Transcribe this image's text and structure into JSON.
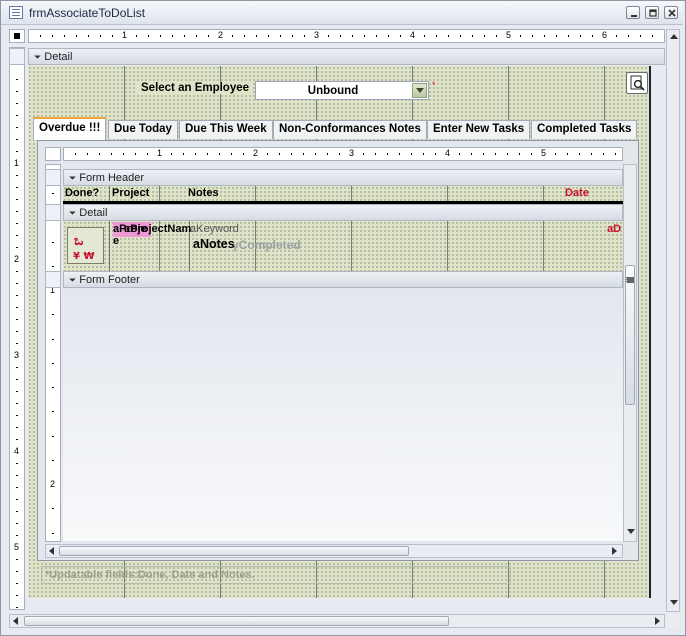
{
  "window": {
    "title": "frmAssociateToDoList"
  },
  "ruler": {
    "top_numbers": [
      "1",
      "2",
      "3",
      "4",
      "5",
      "6"
    ],
    "left_numbers": [
      "1",
      "2",
      "3",
      "4",
      "5"
    ],
    "sub_top_numbers": [
      "1",
      "2",
      "3",
      "4",
      "5"
    ],
    "sub_left_numbers": [
      "1",
      "2"
    ]
  },
  "sections": {
    "detail": "Detail"
  },
  "employee_filter": {
    "label": "Select an Employee",
    "value": "Unbound"
  },
  "tabs": [
    {
      "label": "Overdue !!!",
      "active": true
    },
    {
      "label": "Due Today",
      "active": false
    },
    {
      "label": "Due This Week",
      "active": false
    },
    {
      "label": "Non-Conformances Notes",
      "active": false
    },
    {
      "label": "Enter New Tasks",
      "active": false
    },
    {
      "label": "Completed Tasks",
      "active": false
    }
  ],
  "subform": {
    "form_header": "Form Header",
    "detail": "Detail",
    "form_footer": "Form Footer",
    "columns": {
      "done": "Done?",
      "project": "Project",
      "notes": "Notes",
      "date": "Date"
    },
    "fields": {
      "project_label_part1": "aProje",
      "project_label_part2": "e",
      "project_name": "aProjectNam",
      "keyword": "aKeyword",
      "notes": "aNotes",
      "completed": "yCompleted",
      "date_field": "aD"
    }
  },
  "footer_note": "*Updatable fields:Done, Date and Notes."
}
